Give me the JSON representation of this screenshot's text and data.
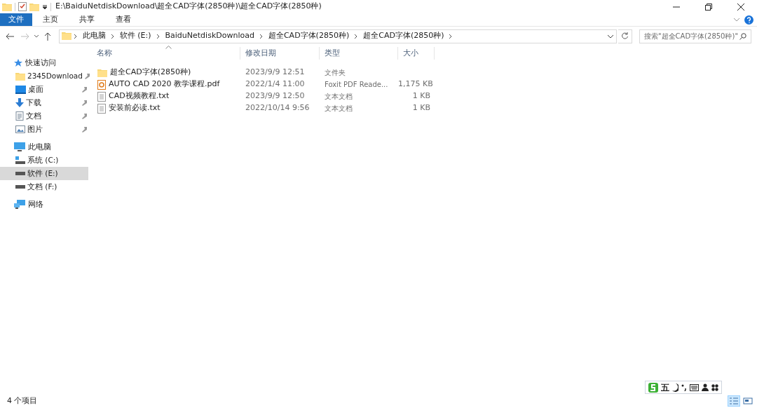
{
  "window": {
    "title": "E:\\BaiduNetdiskDownload\\超全CAD字体(2850种)\\超全CAD字体(2850种)"
  },
  "ribbon_tabs": [
    {
      "label": "文件",
      "kind": "file",
      "selected": false
    },
    {
      "label": "主页",
      "kind": "tab",
      "selected": false
    },
    {
      "label": "共享",
      "kind": "tab",
      "selected": false
    },
    {
      "label": "查看",
      "kind": "tab",
      "selected": false
    }
  ],
  "address_bar": {
    "breadcrumbs": [
      "此电脑",
      "软件 (E:)",
      "BaiduNetdiskDownload",
      "超全CAD字体(2850种)",
      "超全CAD字体(2850种)"
    ]
  },
  "search": {
    "placeholder": "搜索\"超全CAD字体(2850种)\""
  },
  "sidebar": {
    "items": [
      {
        "label": "快速访问",
        "kind": "star",
        "selected": false,
        "children": [
          {
            "label": "2345Download",
            "kind": "folder",
            "pinned": true,
            "selected": false
          },
          {
            "label": "桌面",
            "kind": "desktop",
            "pinned": true,
            "selected": false
          },
          {
            "label": "下载",
            "kind": "download",
            "pinned": true,
            "selected": false
          },
          {
            "label": "文档",
            "kind": "document",
            "pinned": true,
            "selected": false
          },
          {
            "label": "图片",
            "kind": "image",
            "pinned": true,
            "selected": false
          }
        ]
      },
      {
        "label": "此电脑",
        "kind": "pc",
        "selected": false,
        "children": [
          {
            "label": "系统 (C:)",
            "kind": "sysdrive",
            "pinned": false,
            "selected": false
          },
          {
            "label": "软件 (E:)",
            "kind": "drive",
            "pinned": false,
            "selected": true
          },
          {
            "label": "文档 (F:)",
            "kind": "drive",
            "pinned": false,
            "selected": false
          }
        ]
      },
      {
        "label": "网络",
        "kind": "network",
        "selected": false
      }
    ]
  },
  "table": {
    "columns": [
      {
        "label": "名称",
        "sorted": true
      },
      {
        "label": "修改日期",
        "sorted": false
      },
      {
        "label": "类型",
        "sorted": false
      },
      {
        "label": "大小",
        "sorted": false
      }
    ],
    "rows": [
      {
        "name": "超全CAD字体(2850种)",
        "date": "2023/9/9 12:51",
        "type": "文件夹",
        "size": "",
        "kind": "folder"
      },
      {
        "name": "AUTO  CAD 2020 教学课程.pdf",
        "date": "2022/1/4 11:00",
        "type": "Foxit PDF Reade...",
        "size": "1,175 KB",
        "kind": "pdf"
      },
      {
        "name": "CAD视频教程.txt",
        "date": "2023/9/9 12:50",
        "type": "文本文档",
        "size": "1 KB",
        "kind": "txt"
      },
      {
        "name": "安装前必读.txt",
        "date": "2022/10/14 9:56",
        "type": "文本文档",
        "size": "1 KB",
        "kind": "txt"
      }
    ]
  },
  "ime_bar": {
    "mode": "五"
  },
  "status_bar": {
    "count": "4 个项目",
    "views": [
      {
        "kind": "details",
        "selected": true
      },
      {
        "kind": "tiles",
        "selected": false
      }
    ]
  }
}
